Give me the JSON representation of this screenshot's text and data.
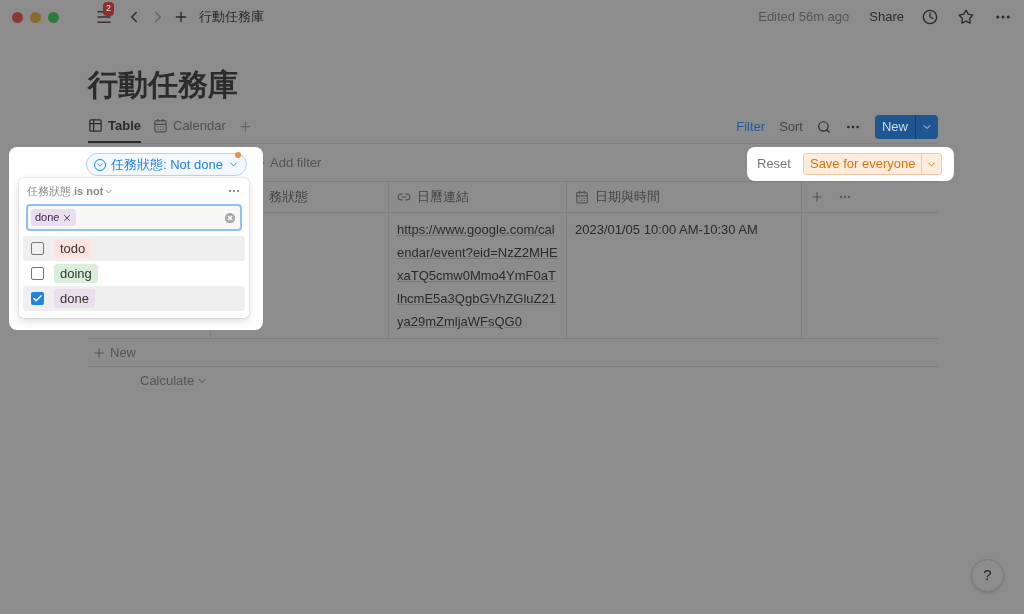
{
  "topbar": {
    "notification_count": "2",
    "breadcrumb": "行動任務庫",
    "edited": "Edited 56m ago",
    "share": "Share"
  },
  "page": {
    "title": "行動任務庫"
  },
  "views": [
    {
      "label": "Table",
      "kind": "table",
      "selected": true
    },
    {
      "label": "Calendar",
      "kind": "calendar",
      "selected": false
    }
  ],
  "toolbar": {
    "filter": "Filter",
    "sort": "Sort",
    "new": "New"
  },
  "filter_bar": {
    "active_filter": "任務狀態: Not done",
    "add_filter": "Add filter",
    "reset": "Reset",
    "save": "Save for everyone"
  },
  "filter_menu": {
    "property": "任務狀態",
    "operator": "is not",
    "chips": [
      "done"
    ],
    "options": [
      {
        "label": "todo",
        "color": "#ffe2dd",
        "checked": false,
        "highlighted": true
      },
      {
        "label": "doing",
        "color": "#dbeddb",
        "checked": false,
        "highlighted": false
      },
      {
        "label": "done",
        "color": "#e8deee",
        "checked": true,
        "highlighted": true
      }
    ]
  },
  "table": {
    "columns": [
      {
        "label": "務狀態"
      },
      {
        "label": "日曆連結",
        "kind": "url"
      },
      {
        "label": "日期與時間",
        "kind": "date"
      }
    ],
    "rows": [
      {
        "calendar_link": "https://www.google.com/calendar/event?eid=NzZ2MHExaTQ5cmw0Mmo4YmF0aTlhcmE5a3QgbGVhZGluZ21ya29mZmljaWFsQG0",
        "date": "2023/01/05 10:00 AM-10:30 AM"
      }
    ],
    "new_row": "New",
    "calculate": "Calculate"
  },
  "help": "?"
}
